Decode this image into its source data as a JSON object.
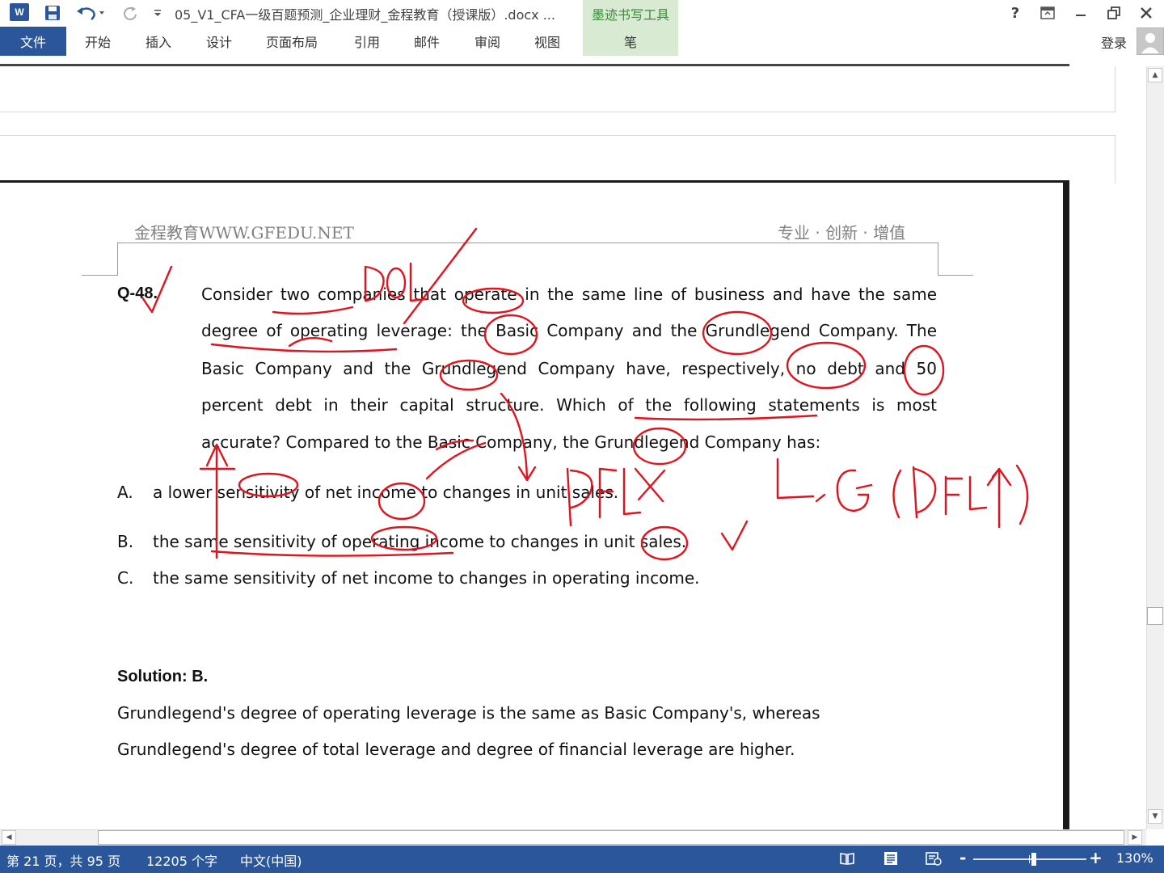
{
  "titlebar": {
    "app_icon": "word-icon",
    "app_icon_letter": "W",
    "doc_title": "05_V1_CFA一级百题预测_企业理财_金程教育（授课版）.docx ...",
    "contextual_tab": "墨迹书写工具",
    "help": "?",
    "window_controls": [
      "ribbon-display-icon",
      "minimize-icon",
      "restore-icon",
      "close-icon"
    ]
  },
  "ribbon": {
    "file": "文件",
    "tabs": [
      "开始",
      "插入",
      "设计",
      "页面布局",
      "引用",
      "邮件",
      "审阅",
      "视图"
    ],
    "pen_tab": "笔",
    "login": "登录"
  },
  "page": {
    "header_left": "金程教育WWW.GFEDU.NET",
    "header_right": "专业 · 创新 · 增值",
    "question": {
      "label": "Q-48.",
      "lines": [
        "Consider two companies that operate in the same line of business and have the same",
        "degree of operating leverage: the Basic Company and the Grundlegend Company. The",
        "Basic Company and the Grundlegend Company have, respectively, no debt and 50",
        "percent debt in their capital structure. Which of the following statements is most",
        "accurate? Compared to the Basic Company, the Grundlegend Company has:"
      ]
    },
    "options": [
      {
        "letter": "A.",
        "text": "a lower sensitivity of net income to changes in unit sales."
      },
      {
        "letter": "B.",
        "text": "the same sensitivity of operating income to changes in unit sales."
      },
      {
        "letter": "C.",
        "text": "the same sensitivity of net income to changes in operating income."
      }
    ],
    "solution": {
      "heading": "Solution: B.",
      "lines": [
        "Grundlegend's degree of operating leverage is the same as Basic Company's, whereas",
        "Grundlegend's degree of total leverage and degree of financial leverage are higher."
      ]
    }
  },
  "ink": {
    "color": "#e0141e",
    "marks": [
      "DOL",
      "DFL",
      "L, G (DFL↑)"
    ]
  },
  "statusbar": {
    "page_info": "第 21 页，共 95 页",
    "word_count": "12205 个字",
    "language": "中文(中国)",
    "zoom_minus": "-",
    "zoom_plus": "+",
    "zoom": "130%",
    "zoom_level_percent": 130
  },
  "colors": {
    "accent": "#2b579a",
    "ink_tab_bg": "#d9ead3",
    "ink_tab_text": "#3a8a3a",
    "ink": "#e0141e"
  }
}
